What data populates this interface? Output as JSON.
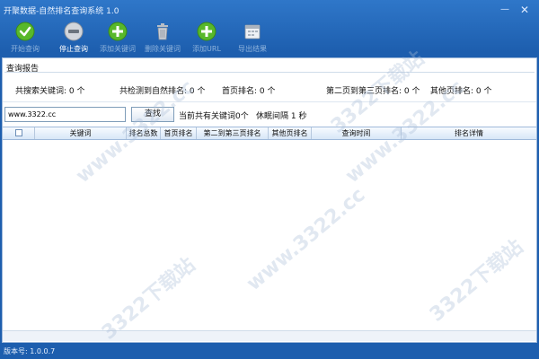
{
  "window": {
    "title": "开聚数据-自然排名查询系统 1.0",
    "min_glyph": "—",
    "close_glyph": "✕"
  },
  "toolbar": {
    "items": [
      {
        "label": "开始查询",
        "icon": "check-icon",
        "enabled": false
      },
      {
        "label": "停止查询",
        "icon": "stop-icon",
        "enabled": true
      },
      {
        "label": "添加关键词",
        "icon": "plus-icon",
        "enabled": false
      },
      {
        "label": "删除关键词",
        "icon": "trash-icon",
        "enabled": false
      },
      {
        "label": "添加URL",
        "icon": "plus-icon",
        "enabled": false
      },
      {
        "label": "导出结果",
        "icon": "calendar-icon",
        "enabled": false
      }
    ]
  },
  "report": {
    "title": "查询报告",
    "stats": [
      "共搜索关键词: 0 个",
      "共检测到自然排名: 0 个",
      "首页排名: 0 个",
      "第二页到第三页排名: 0 个",
      "其他页排名: 0 个"
    ]
  },
  "search": {
    "value": "www.3322.cc",
    "button": "查找",
    "keyword_count": "当前共有关键词0个",
    "interval": "休眠间隔 1 秒"
  },
  "table": {
    "columns": [
      "关键词",
      "排名总数",
      "首页排名",
      "第二到第三页排名",
      "其他页排名",
      "查询时间",
      "排名详情"
    ]
  },
  "statusbar": {
    "version": "版本号: 1.0.0.7"
  },
  "watermark": {
    "text1": "www.3322.cc",
    "text2": "3322下载站"
  },
  "colors": {
    "titlebar": "#2f77c9",
    "background": "#1d5eae",
    "table_header": "#d7e6f7",
    "icon_green": "#58b82a",
    "icon_gray": "#c9ced6"
  }
}
